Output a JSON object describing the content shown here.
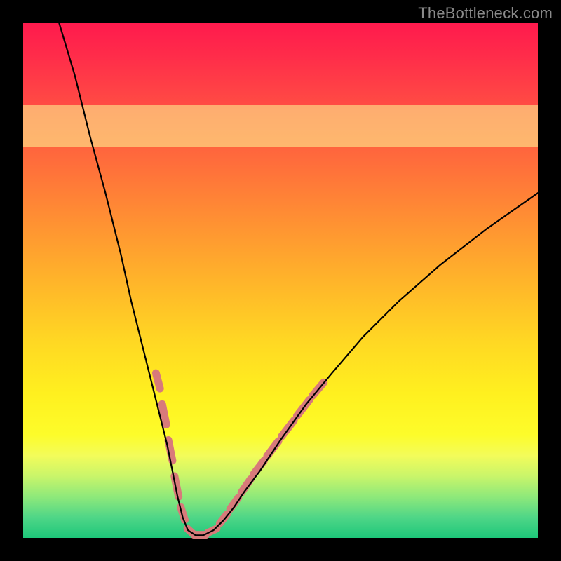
{
  "watermark": "TheBottleneck.com",
  "colors": {
    "background": "#000000",
    "pale_yellow_band": "#fdfd96",
    "dash_stroke": "#d87a7a",
    "curve_stroke": "#000000"
  },
  "chart_data": {
    "type": "line",
    "title": "",
    "xlabel": "",
    "ylabel": "",
    "xlim": [
      0,
      100
    ],
    "ylim": [
      0,
      100
    ],
    "grid": false,
    "legend": false,
    "annotations": [],
    "band": {
      "y0": 76,
      "y1": 84
    },
    "series": [
      {
        "name": "curve",
        "x": [
          7,
          10,
          13,
          16,
          19,
          21,
          23,
          25,
          26.5,
          28,
          29,
          30,
          31,
          32,
          33.5,
          35,
          37,
          39,
          41,
          43,
          46,
          50,
          55,
          60,
          66,
          73,
          81,
          90,
          100
        ],
        "y": [
          100,
          90,
          78,
          67,
          55,
          46,
          38,
          30,
          24,
          18,
          13,
          8,
          4,
          1.5,
          0.5,
          0.5,
          1.5,
          3.5,
          6,
          9,
          13,
          19,
          26,
          32,
          39,
          46,
          53,
          60,
          67
        ]
      }
    ],
    "dash_segments_left": [
      {
        "x0": 25.8,
        "y0": 32,
        "x1": 26.6,
        "y1": 29
      },
      {
        "x0": 27.0,
        "y0": 26,
        "x1": 27.8,
        "y1": 22
      },
      {
        "x0": 28.2,
        "y0": 19,
        "x1": 29.0,
        "y1": 15
      },
      {
        "x0": 29.4,
        "y0": 12,
        "x1": 30.2,
        "y1": 8
      },
      {
        "x0": 30.6,
        "y0": 6,
        "x1": 31.4,
        "y1": 3.5
      },
      {
        "x0": 31.9,
        "y0": 1.8,
        "x1": 33.0,
        "y1": 0.8
      }
    ],
    "dash_segments_bottom": [
      {
        "x0": 33.2,
        "y0": 0.6,
        "x1": 35.5,
        "y1": 0.6
      },
      {
        "x0": 35.9,
        "y0": 1.0,
        "x1": 37.6,
        "y1": 1.8
      }
    ],
    "dash_segments_right": [
      {
        "x0": 38.2,
        "y0": 2.8,
        "x1": 39.6,
        "y1": 4.6
      },
      {
        "x0": 40.2,
        "y0": 5.6,
        "x1": 41.8,
        "y1": 7.8
      },
      {
        "x0": 42.4,
        "y0": 8.8,
        "x1": 44.2,
        "y1": 11.4
      },
      {
        "x0": 44.8,
        "y0": 12.4,
        "x1": 46.8,
        "y1": 15.0
      },
      {
        "x0": 47.4,
        "y0": 15.9,
        "x1": 49.6,
        "y1": 18.8
      },
      {
        "x0": 50.2,
        "y0": 19.7,
        "x1": 52.6,
        "y1": 22.8
      },
      {
        "x0": 53.2,
        "y0": 23.7,
        "x1": 55.6,
        "y1": 26.8
      },
      {
        "x0": 56.2,
        "y0": 27.6,
        "x1": 58.4,
        "y1": 30.2
      }
    ]
  }
}
